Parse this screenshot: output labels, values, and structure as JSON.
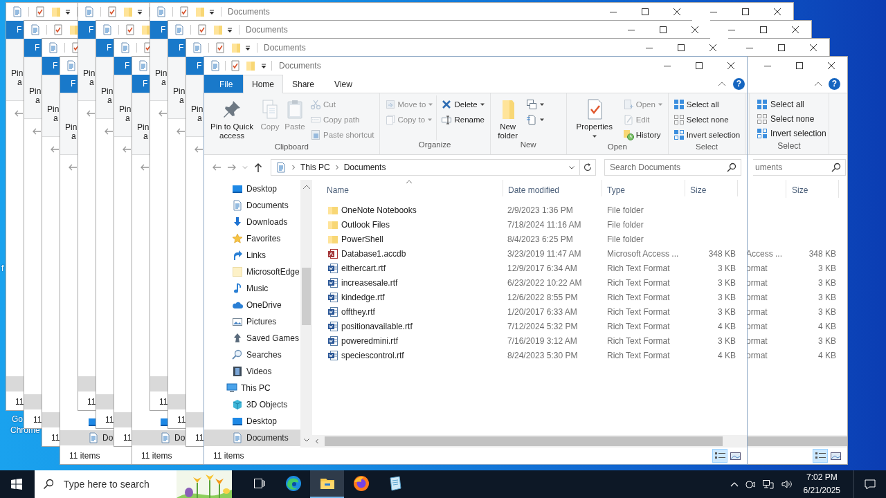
{
  "desktop_texts": [
    {
      "text": "f"
    },
    {
      "text": "Go"
    },
    {
      "text": "Chrome"
    }
  ],
  "background_windows": [
    {
      "kind": "left_strip",
      "file_tab": "F",
      "ribbon_lines": [
        "Pin",
        "a"
      ],
      "status": "11"
    },
    {
      "kind": "left_strip",
      "file_tab": "F",
      "ribbon_lines": [
        "Pin",
        "a"
      ],
      "status": "11"
    },
    {
      "kind": "left_strip",
      "file_tab": "F",
      "ribbon_lines": [
        "Pin",
        "a"
      ],
      "status": "11"
    },
    {
      "kind": "left_strip",
      "file_tab": "F",
      "ribbon_lines": [
        "Pin",
        "a"
      ],
      "desktop_row": true,
      "nav_selected": "Do",
      "status": "11 items"
    },
    {
      "kind": "left_strip",
      "file_tab": "F",
      "ribbon_lines": [
        "Pin",
        "a"
      ],
      "status": "11"
    },
    {
      "kind": "left_strip",
      "file_tab": "F",
      "ribbon_lines": [
        "Pin",
        "a"
      ],
      "status": "11"
    },
    {
      "kind": "left_strip",
      "file_tab": "F",
      "ribbon_lines": [
        "Pin",
        "a"
      ],
      "status": "11"
    },
    {
      "kind": "left_strip",
      "file_tab": "F",
      "ribbon_lines": [
        "Pin",
        "a"
      ],
      "desktop_row": true,
      "nav_selected": "Do",
      "status": "11 items"
    },
    {
      "kind": "left_strip",
      "title": "Documents",
      "caption_buttons": true,
      "file_tab": "F",
      "ribbon_lines": [
        "Pin",
        "a"
      ],
      "status": "11"
    },
    {
      "kind": "left_strip",
      "title": "Documents",
      "caption_buttons": true,
      "file_tab": "F",
      "ribbon_lines": [
        "Pin",
        "a"
      ],
      "status": "11"
    },
    {
      "kind": "left_strip",
      "title": "Documents",
      "caption_buttons": true,
      "file_tab": "F",
      "ribbon_lines": [
        "Pin",
        "a"
      ],
      "status": "11"
    },
    {
      "kind": "caption_strip",
      "caption_buttons": true
    },
    {
      "kind": "caption_strip",
      "caption_buttons": true
    },
    {
      "kind": "caption_strip",
      "caption_buttons": true
    },
    {
      "kind": "right_edge",
      "caption_buttons": true,
      "help": "?",
      "ribbon_group": {
        "label": "Select",
        "items": [
          {
            "label": "Select all",
            "disabled": false
          },
          {
            "label": "Select none",
            "disabled": false
          },
          {
            "label": "Invert selection",
            "disabled": false
          }
        ]
      },
      "search_text": "uments",
      "size_column": "Size",
      "rows": [
        {
          "type": "Access ...",
          "size": "348 KB"
        },
        {
          "type": "ormat",
          "size": "3 KB"
        },
        {
          "type": "ormat",
          "size": "3 KB"
        },
        {
          "type": "ormat",
          "size": "3 KB"
        },
        {
          "type": "ormat",
          "size": "3 KB"
        },
        {
          "type": "ormat",
          "size": "4 KB"
        },
        {
          "type": "ormat",
          "size": "3 KB"
        },
        {
          "type": "ormat",
          "size": "4 KB"
        }
      ],
      "view_buttons": [
        {
          "selected": true
        },
        {
          "selected": false
        }
      ]
    }
  ],
  "window": {
    "title": "Documents",
    "help": "?",
    "tabs": [
      {
        "label": "File",
        "kind": "file",
        "selected": false
      },
      {
        "label": "Home",
        "kind": "tab",
        "selected": true
      },
      {
        "label": "Share",
        "kind": "tab",
        "selected": false
      },
      {
        "label": "View",
        "kind": "tab",
        "selected": false
      }
    ],
    "ribbon": [
      {
        "label": "Clipboard",
        "controls": [
          {
            "kind": "large",
            "label": "Pin to Quick access",
            "disabled": false,
            "dropdown": false
          },
          {
            "kind": "large",
            "label": "Copy",
            "disabled": true,
            "dropdown": false
          },
          {
            "kind": "large",
            "label": "Paste",
            "disabled": true,
            "dropdown": false
          },
          {
            "kind": "stack",
            "items": [
              {
                "label": "Cut",
                "disabled": true,
                "dropdown": false
              },
              {
                "label": "Copy path",
                "disabled": true,
                "dropdown": false
              },
              {
                "label": "Paste shortcut",
                "disabled": true,
                "dropdown": false
              }
            ]
          }
        ]
      },
      {
        "label": "Organize",
        "controls": [
          {
            "kind": "stack",
            "items": [
              {
                "label": "Move to",
                "disabled": true,
                "dropdown": true
              },
              {
                "label": "Copy to",
                "disabled": true,
                "dropdown": true
              }
            ]
          },
          {
            "kind": "stack",
            "items": [
              {
                "label": "Delete",
                "disabled": false,
                "dropdown": true
              },
              {
                "label": "Rename",
                "disabled": false,
                "dropdown": false
              }
            ]
          }
        ]
      },
      {
        "label": "New",
        "controls": [
          {
            "kind": "large",
            "label": "New folder",
            "disabled": false,
            "dropdown": false
          },
          {
            "kind": "stack",
            "items": [
              {
                "disabled": false,
                "dropdown": true
              },
              {
                "disabled": false,
                "dropdown": true
              }
            ]
          }
        ]
      },
      {
        "label": "Open",
        "controls": [
          {
            "kind": "large",
            "label": "Properties",
            "disabled": false,
            "dropdown": true
          },
          {
            "kind": "stack",
            "items": [
              {
                "label": "Open",
                "disabled": true,
                "dropdown": true
              },
              {
                "label": "Edit",
                "disabled": true,
                "dropdown": false
              },
              {
                "label": "History",
                "disabled": false,
                "dropdown": false
              }
            ]
          }
        ]
      },
      {
        "label": "Select",
        "controls": [
          {
            "kind": "stack",
            "items": [
              {
                "label": "Select all",
                "disabled": false,
                "dropdown": false
              },
              {
                "label": "Select none",
                "disabled": false,
                "dropdown": false
              },
              {
                "label": "Invert selection",
                "disabled": false,
                "dropdown": false
              }
            ]
          }
        ]
      }
    ],
    "address": {
      "buttons": [
        {
          "disabled": true
        },
        {
          "disabled": true
        },
        {
          "disabled": true
        },
        {
          "disabled": false
        }
      ],
      "path": [
        "This PC",
        "Documents"
      ],
      "search_placeholder": "Search Documents"
    },
    "nav_pane": {
      "items": [
        {
          "children": [
            {
              "label": "Desktop",
              "selected": false
            },
            {
              "label": "Documents",
              "selected": false
            },
            {
              "label": "Downloads",
              "selected": false
            },
            {
              "label": "Favorites",
              "selected": false
            },
            {
              "label": "Links",
              "selected": false
            },
            {
              "label": "MicrosoftEdge",
              "selected": false
            },
            {
              "label": "Music",
              "selected": false
            },
            {
              "label": "OneDrive",
              "selected": false
            },
            {
              "label": "Pictures",
              "selected": false
            },
            {
              "label": "Saved Games",
              "selected": false
            },
            {
              "label": "Searches",
              "selected": false
            },
            {
              "label": "Videos",
              "selected": false
            }
          ]
        },
        {
          "label": "This PC",
          "selected": false,
          "children": [
            {
              "label": "3D Objects",
              "selected": false
            },
            {
              "label": "Desktop",
              "selected": false
            },
            {
              "label": "Documents",
              "selected": true
            }
          ]
        }
      ]
    },
    "file_list": {
      "columns": [
        {
          "label": "Name",
          "sorted": true
        },
        {
          "label": "Date modified",
          "sorted": false
        },
        {
          "label": "Type",
          "sorted": false
        },
        {
          "label": "Size",
          "sorted": false
        }
      ],
      "rows": [
        {
          "kind": "folder",
          "name": "OneNote Notebooks",
          "date": "2/9/2023 1:36 PM",
          "type": "File folder"
        },
        {
          "kind": "folder",
          "name": "Outlook Files",
          "date": "7/18/2024 11:16 AM",
          "type": "File folder"
        },
        {
          "kind": "folder",
          "name": "PowerShell",
          "date": "8/4/2023 6:25 PM",
          "type": "File folder"
        },
        {
          "kind": "access",
          "name": "Database1.accdb",
          "date": "3/23/2019 11:47 AM",
          "type": "Microsoft Access ...",
          "size": "348 KB"
        },
        {
          "kind": "rtf",
          "name": "eithercart.rtf",
          "date": "12/9/2017 6:34 AM",
          "type": "Rich Text Format",
          "size": "3 KB"
        },
        {
          "kind": "rtf",
          "name": "increasesale.rtf",
          "date": "6/23/2022 10:22 AM",
          "type": "Rich Text Format",
          "size": "3 KB"
        },
        {
          "kind": "rtf",
          "name": "kindedge.rtf",
          "date": "12/6/2022 8:55 PM",
          "type": "Rich Text Format",
          "size": "3 KB"
        },
        {
          "kind": "rtf",
          "name": "offthey.rtf",
          "date": "1/20/2017 6:33 AM",
          "type": "Rich Text Format",
          "size": "3 KB"
        },
        {
          "kind": "rtf",
          "name": "positionavailable.rtf",
          "date": "7/12/2024 5:32 PM",
          "type": "Rich Text Format",
          "size": "4 KB"
        },
        {
          "kind": "rtf",
          "name": "poweredmini.rtf",
          "date": "7/16/2019 3:12 AM",
          "type": "Rich Text Format",
          "size": "3 KB"
        },
        {
          "kind": "rtf",
          "name": "speciescontrol.rtf",
          "date": "8/24/2023 5:30 PM",
          "type": "Rich Text Format",
          "size": "4 KB"
        }
      ]
    },
    "status_bar": {
      "text": "11 items",
      "view_buttons": [
        {
          "selected": true
        },
        {
          "selected": false
        }
      ]
    }
  },
  "taskbar": {
    "search_placeholder": "Type here to search",
    "apps": [
      {
        "active": false
      },
      {
        "active": false
      },
      {
        "active": true
      },
      {
        "active": false
      },
      {
        "active": false
      }
    ],
    "time": "7:02 PM",
    "date": "6/21/2025"
  }
}
